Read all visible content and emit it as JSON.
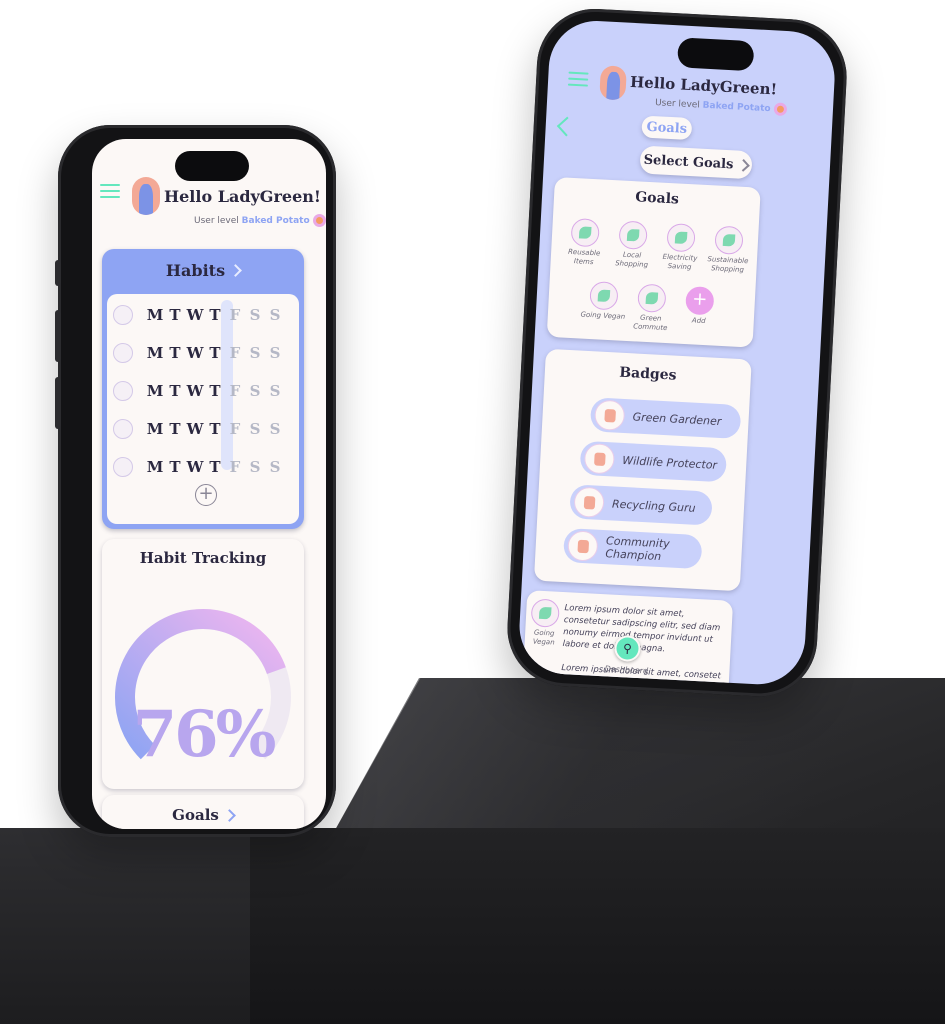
{
  "greeting": "Hello LadyGreen!",
  "user_level_prefix": "User level",
  "user_level": "Baked Potato",
  "habits": {
    "title": "Habits",
    "days": [
      "M",
      "T",
      "W",
      "T",
      "F",
      "S",
      "S"
    ],
    "rows": [
      {
        "icon": "bowl-icon",
        "done": [
          true,
          false,
          true,
          false,
          false,
          false,
          false
        ]
      },
      {
        "icon": "bulb-icon",
        "done": [
          true,
          true,
          true,
          false,
          false,
          false,
          false
        ]
      },
      {
        "icon": "bike-icon",
        "done": [
          false,
          true,
          true,
          true,
          false,
          false,
          false
        ]
      },
      {
        "icon": "bag-icon",
        "done": [
          true,
          true,
          true,
          false,
          false,
          false,
          false
        ]
      },
      {
        "icon": "sprout-icon",
        "done": [
          true,
          true,
          true,
          false,
          false,
          false,
          false
        ]
      }
    ],
    "add_label": "+"
  },
  "tracking": {
    "title": "Habit Tracking",
    "percent_label": "76%",
    "progress": 0.76
  },
  "goals_strip": {
    "label": "Goals"
  },
  "goals_screen": {
    "header_label": "Goals",
    "select_label": "Select Goals",
    "card_title": "Goals",
    "items": [
      {
        "label": "Reusable Items"
      },
      {
        "label": "Local Shopping"
      },
      {
        "label": "Electricity Saving"
      },
      {
        "label": "Sustainable Shopping"
      },
      {
        "label": "Going Vegan"
      },
      {
        "label": "Green Commute"
      },
      {
        "label": "Add"
      }
    ],
    "badges_title": "Badges",
    "badges": [
      {
        "label": "Green Gardener"
      },
      {
        "label": "Wildlife Protector"
      },
      {
        "label": "Recycling Guru"
      },
      {
        "label": "Community Champion"
      }
    ],
    "feed": {
      "item_label": "Going Vegan",
      "text": "Lorem ipsum dolor sit amet, consetetur sadipscing elitr, sed diam nonumy eirmod tempor invidunt ut labore et dolore magna.",
      "text2": "Lorem ipsum dolor sit amet, consetetur"
    },
    "nav": {
      "dashboard_label": "Dashboard"
    }
  },
  "colors": {
    "accent": "#8ea4f3",
    "green": "#64e7bd",
    "pink": "#ea9fec",
    "card": "#fcf8f6",
    "bg_blue": "#c9d1fb"
  }
}
